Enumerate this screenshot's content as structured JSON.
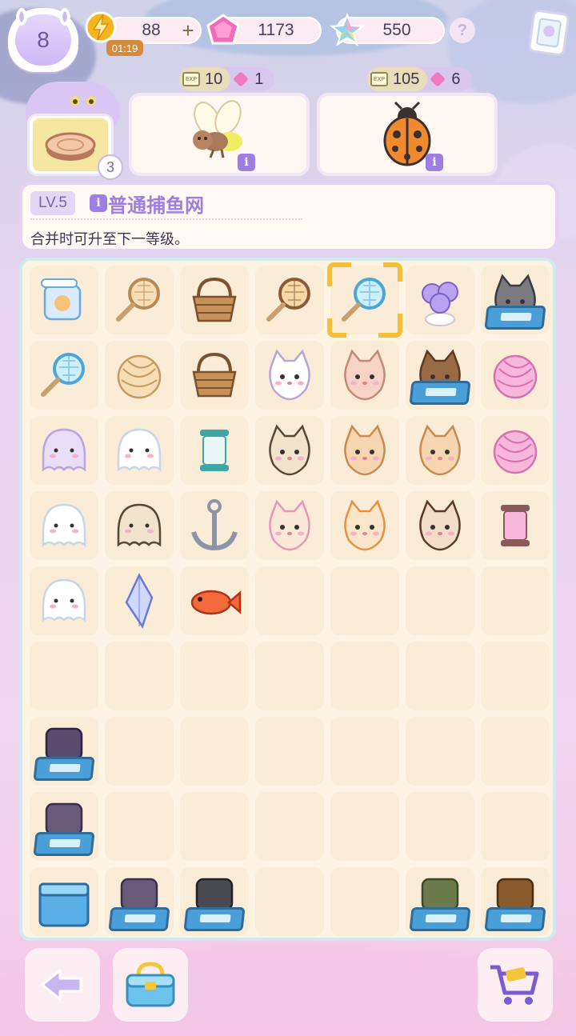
{
  "player": {
    "level": "8"
  },
  "resources": {
    "energy": {
      "value": "88",
      "timer": "01:19",
      "plus": "+",
      "icon": "lightning-icon"
    },
    "gems": {
      "value": "1173",
      "icon": "pink-gem-icon"
    },
    "stars": {
      "value": "550",
      "icon": "rainbow-star-icon"
    },
    "help": "?"
  },
  "producer": {
    "icon": "wood-log-icon",
    "count": "3"
  },
  "orders": [
    {
      "xp": "10",
      "gems": "1",
      "item": "firefly-bug-icon"
    },
    {
      "xp": "105",
      "gems": "6",
      "item": "ladybug-icon"
    }
  ],
  "selected_item": {
    "level": "LV.5",
    "info": "i",
    "name": "普通捕鱼网",
    "description": "合并时可升至下一等级。"
  },
  "board": {
    "rows": 9,
    "cols": 7,
    "selected": [
      0,
      4
    ],
    "items": [
      [
        "mixer-icon",
        "fishing-net-bundle-icon",
        "basket-with-lemon-icon",
        "heart-racket-icon",
        "magnifier-net-icon",
        "violet-flower-pot-icon",
        "gray-cat-crate-icon"
      ],
      [
        "small-net-icon",
        "yarn-spool-icon",
        "empty-basket-icon",
        "white-unicorn-cat-icon",
        "pink-hamster-icon",
        "tabby-cat-crate-icon",
        "yarn-ball-pink-icon"
      ],
      [
        "lavender-ghost-cat-icon",
        "white-ghost-icon",
        "thread-spool-icon",
        "siamese-cat-icon",
        "hamster-hat-icon",
        "hamster-book-icon",
        "big-yarn-ball-icon"
      ],
      [
        "small-ghost-icon",
        "siamese-ghost-icon",
        "anchor-icon",
        "pink-bow-cat-icon",
        "orange-cat-mail-icon",
        "calico-cat-icon",
        "pink-thread-spool-icon"
      ],
      [
        "round-ghost-icon",
        "crystal-shard-icon",
        "goldfish-icon",
        "",
        "",
        "",
        ""
      ],
      [
        "",
        "",
        "",
        "",
        "",
        "",
        ""
      ],
      [
        "circuit-board-crate-icon",
        "",
        "",
        "",
        "",
        "",
        ""
      ],
      [
        "satellite-dish-crate-icon",
        "",
        "",
        "",
        "",
        "",
        ""
      ],
      [
        "blue-gift-box-icon",
        "ribbon-crate-icon",
        "hair-dryer-crate-icon",
        "",
        "",
        "money-bag-crate-icon",
        "beetle-crate-icon"
      ]
    ]
  },
  "bottom": {
    "back": "back-arrow-icon",
    "basket": "storage-basket-icon",
    "cart": "shopping-cart-icon"
  },
  "colors": {
    "accent": "#9e7ee4",
    "selection": "#f5bf3a",
    "cell": "#fbecd8"
  }
}
